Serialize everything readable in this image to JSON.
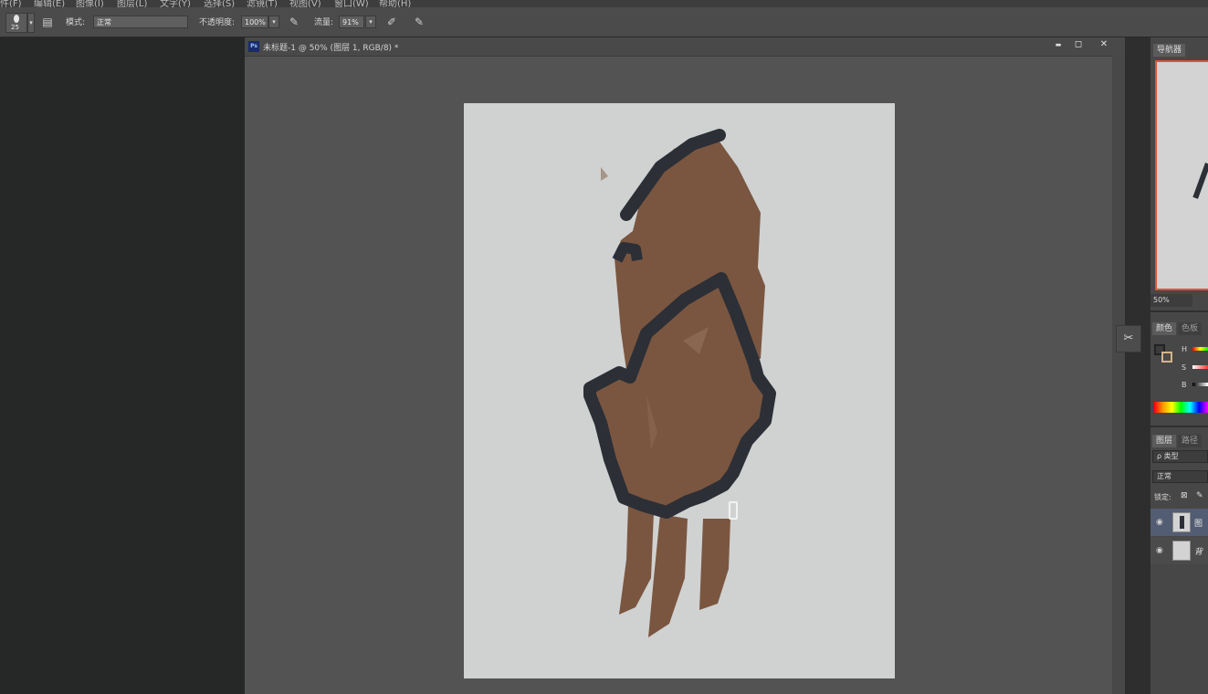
{
  "menu": {
    "items": [
      "件(F)",
      "编辑(E)",
      "图像(I)",
      "图层(L)",
      "文字(Y)",
      "选择(S)",
      "滤镜(T)",
      "视图(V)",
      "窗口(W)",
      "帮助(H)"
    ]
  },
  "options": {
    "brush_size": "25",
    "mode_label": "模式:",
    "mode_value": "正常",
    "opacity_label": "不透明度:",
    "opacity_value": "100%",
    "flow_label": "流量:",
    "flow_value": "91%"
  },
  "document": {
    "title": "未标题-1 @ 50% (图层 1, RGB/8) *",
    "ps_badge": "Ps",
    "minimize": "▬",
    "restore": "◻",
    "close": "✕"
  },
  "navigator": {
    "tab": "导航器",
    "zoom": "50%"
  },
  "color_panel": {
    "tab_color": "颜色",
    "tab_swatches": "色板",
    "h_label": "H",
    "s_label": "S",
    "b_label": "B"
  },
  "layers_panel": {
    "tab_layers": "图层",
    "tab_paths": "路径",
    "filter": "ρ 类型",
    "blend": "正常",
    "lock_label": "锁定:",
    "layers": [
      {
        "name": "图"
      },
      {
        "name": "背"
      }
    ]
  },
  "colors": {
    "canvas": "#d0d2d1",
    "leather": "#7a5640",
    "outline": "#2c2f36",
    "accent": "#e0533a"
  }
}
